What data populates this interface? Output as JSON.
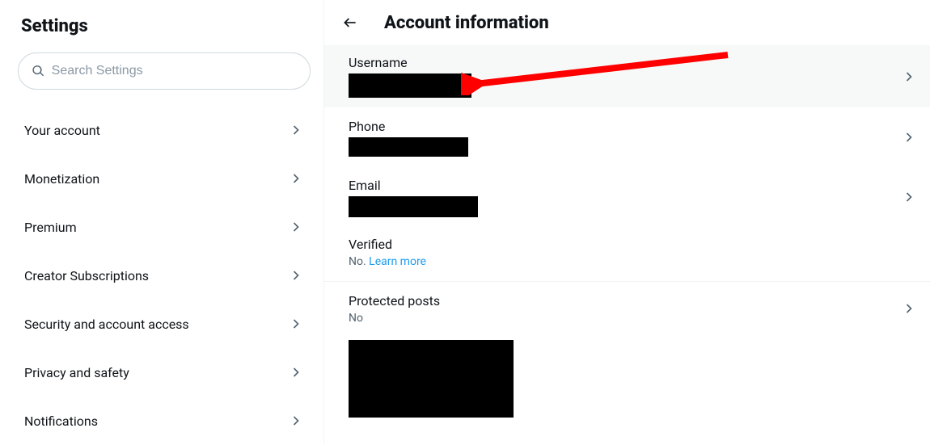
{
  "sidebar": {
    "title": "Settings",
    "search_placeholder": "Search Settings",
    "items": [
      {
        "label": "Your account"
      },
      {
        "label": "Monetization"
      },
      {
        "label": "Premium"
      },
      {
        "label": "Creator Subscriptions"
      },
      {
        "label": "Security and account access"
      },
      {
        "label": "Privacy and safety"
      },
      {
        "label": "Notifications"
      }
    ]
  },
  "main": {
    "title": "Account information",
    "rows": {
      "username": {
        "label": "Username"
      },
      "phone": {
        "label": "Phone"
      },
      "email": {
        "label": "Email"
      },
      "verified": {
        "label": "Verified",
        "value": "No.",
        "link": "Learn more"
      },
      "protected": {
        "label": "Protected posts",
        "value": "No"
      }
    }
  }
}
